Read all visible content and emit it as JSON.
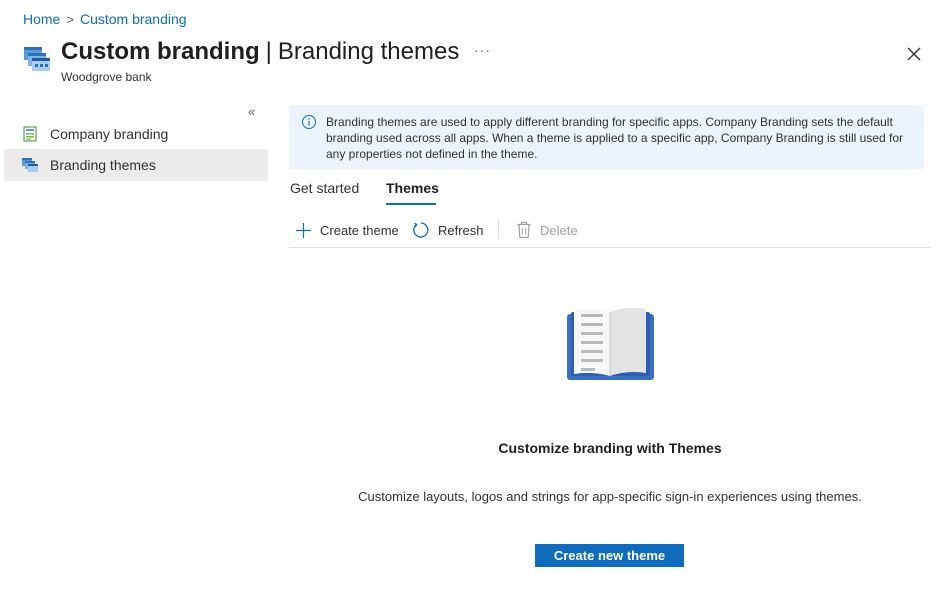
{
  "breadcrumb": {
    "home": "Home",
    "separator": ">",
    "current": "Custom branding"
  },
  "header": {
    "title": "Custom branding",
    "pipe": "|",
    "subtitle_title": "Branding themes",
    "more": "···",
    "tenant": "Woodgrove bank",
    "icon": "branding-icon",
    "close_icon": "close-icon"
  },
  "sidebar": {
    "collapse": "«",
    "items": [
      {
        "label": "Company branding",
        "icon": "company-branding-icon",
        "selected": false
      },
      {
        "label": "Branding themes",
        "icon": "branding-themes-icon",
        "selected": true
      }
    ]
  },
  "info_banner": {
    "icon": "info-icon",
    "text": "Branding themes are used to apply different branding for specific apps. Company Branding sets the default branding used across all apps. When a theme is applied to a specific app, Company Branding is still used for any properties not defined in the theme."
  },
  "tabs": [
    {
      "label": "Get started",
      "active": false
    },
    {
      "label": "Themes",
      "active": true
    }
  ],
  "toolbar": {
    "create": "Create theme",
    "refresh": "Refresh",
    "delete": "Delete"
  },
  "empty_state": {
    "icon": "book-icon",
    "title": "Customize branding with Themes",
    "description": "Customize layouts, logos and strings for app-specific sign-in experiences using themes.",
    "button": "Create new theme"
  },
  "colors": {
    "accent": "#0f6cbd",
    "banner_bg": "#ebf3fc",
    "selected_nav": "#edebe9"
  }
}
